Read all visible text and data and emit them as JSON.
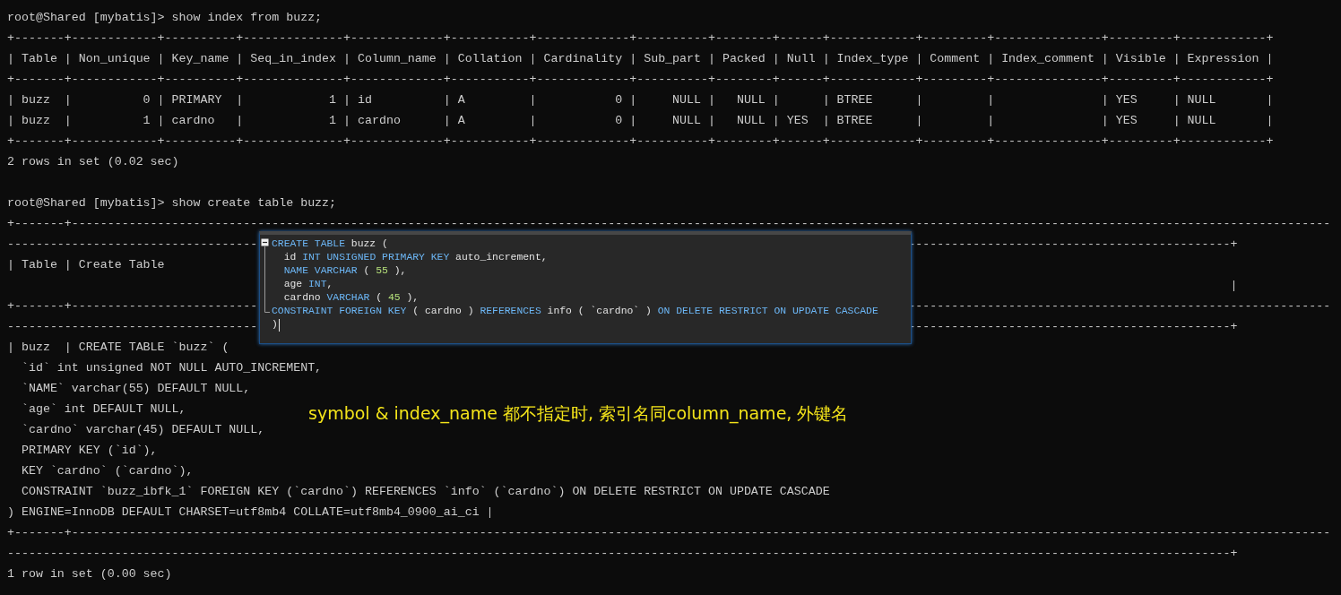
{
  "terminal": {
    "blocks": [
      {
        "lines": [
          {
            "text": "root@Shared [mybatis]> show index from buzz;"
          },
          {
            "text": "+-------+------------+----------+--------------+-------------+-----------+-------------+----------+--------+------+------------+---------+---------------+---------+------------+"
          },
          {
            "text": "| Table | Non_unique | Key_name | Seq_in_index | Column_name | Collation | Cardinality | Sub_part | Packed | Null | Index_type | Comment | Index_comment | Visible | Expression |"
          },
          {
            "text": "+-------+------------+----------+--------------+-------------+-----------+-------------+----------+--------+------+------------+---------+---------------+---------+------------+"
          },
          {
            "text": "| buzz  |          0 | PRIMARY  |            1 | id          | A         |           0 |     NULL |   NULL |      | BTREE      |         |               | YES     | NULL       |"
          },
          {
            "text": "| buzz  |          1 | cardno   |            1 | cardno      | A         |           0 |     NULL |   NULL | YES  | BTREE      |         |               | YES     | NULL       |"
          },
          {
            "text": "+-------+------------+----------+--------------+-------------+-----------+-------------+----------+--------+------+------------+---------+---------------+---------+------------+"
          },
          {
            "text": "2 rows in set (0.02 sec)"
          }
        ]
      },
      {
        "lines": [
          {
            "text": "root@Shared [mybatis]> show create table buzz;"
          },
          {
            "text": "+-------+--------------------------------------------------------------------------------------------------------------------------------------------------------------------------------"
          },
          {
            "left": "-----------------------------------",
            "right": "---------------------------------------------+"
          },
          {
            "left": "| Table | Create Table"
          },
          {
            "right": "                                             |"
          },
          {
            "left": "+-------+--------------------------",
            "right": "-----------------------------------------------------------"
          },
          {
            "left": "-----------------------------------",
            "right": "---------------------------------------------+"
          },
          {
            "text": "| buzz  | CREATE TABLE `buzz` ("
          },
          {
            "text": "  `id` int unsigned NOT NULL AUTO_INCREMENT,"
          },
          {
            "text": "  `NAME` varchar(55) DEFAULT NULL,"
          },
          {
            "text": "  `age` int DEFAULT NULL,"
          },
          {
            "text": "  `cardno` varchar(45) DEFAULT NULL,"
          },
          {
            "text": "  PRIMARY KEY (`id`),"
          },
          {
            "text": "  KEY `cardno` (`cardno`),"
          },
          {
            "text": "  CONSTRAINT `buzz_ibfk_1` FOREIGN KEY (`cardno`) REFERENCES `info` (`cardno`) ON DELETE RESTRICT ON UPDATE CASCADE"
          },
          {
            "text": ") ENGINE=InnoDB DEFAULT CHARSET=utf8mb4 COLLATE=utf8mb4_0900_ai_ci |"
          },
          {
            "text": "+-------+--------------------------------------------------------------------------------------------------------------------------------------------------------------------------------"
          },
          {
            "text": "---------------------------------------------------------------------------------------------------------------------------------------------------------------------------+"
          },
          {
            "text": "1 row in set (0.00 sec)"
          }
        ]
      }
    ]
  },
  "popup": {
    "lines": [
      [
        {
          "kind": "keyword",
          "text": "CREATE TABLE"
        },
        {
          "kind": "plain",
          "text": " buzz ("
        }
      ],
      [
        {
          "kind": "plain",
          "text": "  id "
        },
        {
          "kind": "keyword",
          "text": "INT UNSIGNED PRIMARY KEY"
        },
        {
          "kind": "plain",
          "text": " auto_increment,"
        }
      ],
      [
        {
          "kind": "keyword",
          "text": "  NAME VARCHAR"
        },
        {
          "kind": "plain",
          "text": " ( "
        },
        {
          "kind": "number",
          "text": "55"
        },
        {
          "kind": "plain",
          "text": " ),"
        }
      ],
      [
        {
          "kind": "plain",
          "text": "  age "
        },
        {
          "kind": "keyword",
          "text": "INT"
        },
        {
          "kind": "plain",
          "text": ","
        }
      ],
      [
        {
          "kind": "plain",
          "text": "  cardno "
        },
        {
          "kind": "keyword",
          "text": "VARCHAR"
        },
        {
          "kind": "plain",
          "text": " ( "
        },
        {
          "kind": "number",
          "text": "45"
        },
        {
          "kind": "plain",
          "text": " ),"
        }
      ],
      [
        {
          "kind": "keyword",
          "text": "CONSTRAINT FOREIGN KEY"
        },
        {
          "kind": "plain",
          "text": " ( cardno ) "
        },
        {
          "kind": "keyword",
          "text": "REFERENCES"
        },
        {
          "kind": "plain",
          "text": " info ( `cardno` ) "
        },
        {
          "kind": "keyword",
          "text": "ON DELETE RESTRICT ON UPDATE CASCADE"
        }
      ],
      [
        {
          "kind": "plain",
          "text": ")"
        }
      ]
    ]
  },
  "annotation": "symbol & index_name 都不指定时, 索引名同column_name, 外键名"
}
